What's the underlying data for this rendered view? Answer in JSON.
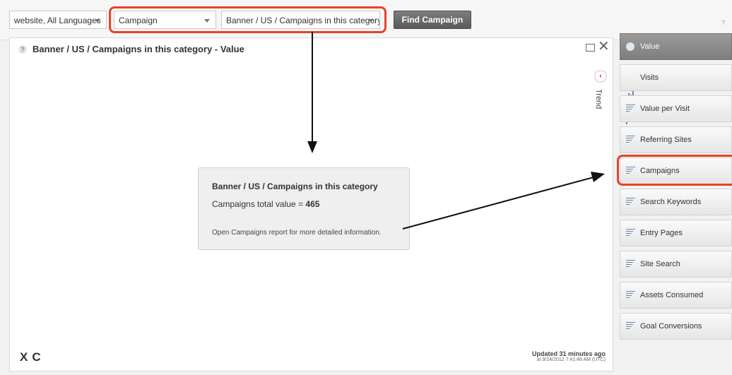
{
  "toolbar": {
    "website_select": "website, All Languages",
    "type_select": "Campaign",
    "item_select": "Banner / US / Campaigns in this category",
    "find_button": "Find Campaign",
    "help_symbol": "?"
  },
  "panel": {
    "help_symbol": "?",
    "title": "Banner / US / Campaigns in this category - Value",
    "trend_label": "Trend",
    "info": {
      "title": "Banner / US / Campaigns in this category",
      "total_label": "Campaigns total value = ",
      "total_value": "465",
      "link_text": "Open Campaigns report for more detailed information."
    },
    "updated_line1": "Updated 31 minutes ago",
    "updated_line2": "at 9/24/2012 7:41:48 AM (UTC)"
  },
  "sidebar": {
    "items": [
      {
        "label": "Value",
        "icon": "pie-icon",
        "active": true
      },
      {
        "label": "Visits",
        "icon": "bar-chart-icon",
        "active": false
      },
      {
        "label": "Value per Visit",
        "icon": "list-icon",
        "active": false
      },
      {
        "label": "Referring Sites",
        "icon": "list-icon",
        "active": false
      },
      {
        "label": "Campaigns",
        "icon": "list-icon",
        "active": false
      },
      {
        "label": "Search Keywords",
        "icon": "list-icon",
        "active": false
      },
      {
        "label": "Entry Pages",
        "icon": "list-icon",
        "active": false
      },
      {
        "label": "Site Search",
        "icon": "list-icon",
        "active": false
      },
      {
        "label": "Assets Consumed",
        "icon": "list-icon",
        "active": false
      },
      {
        "label": "Goal Conversions",
        "icon": "list-icon",
        "active": false
      }
    ]
  },
  "colors": {
    "annotation_red": "#e8432b",
    "icon_blue": "#6a89a8",
    "active_tab": "#8a8a8a"
  }
}
